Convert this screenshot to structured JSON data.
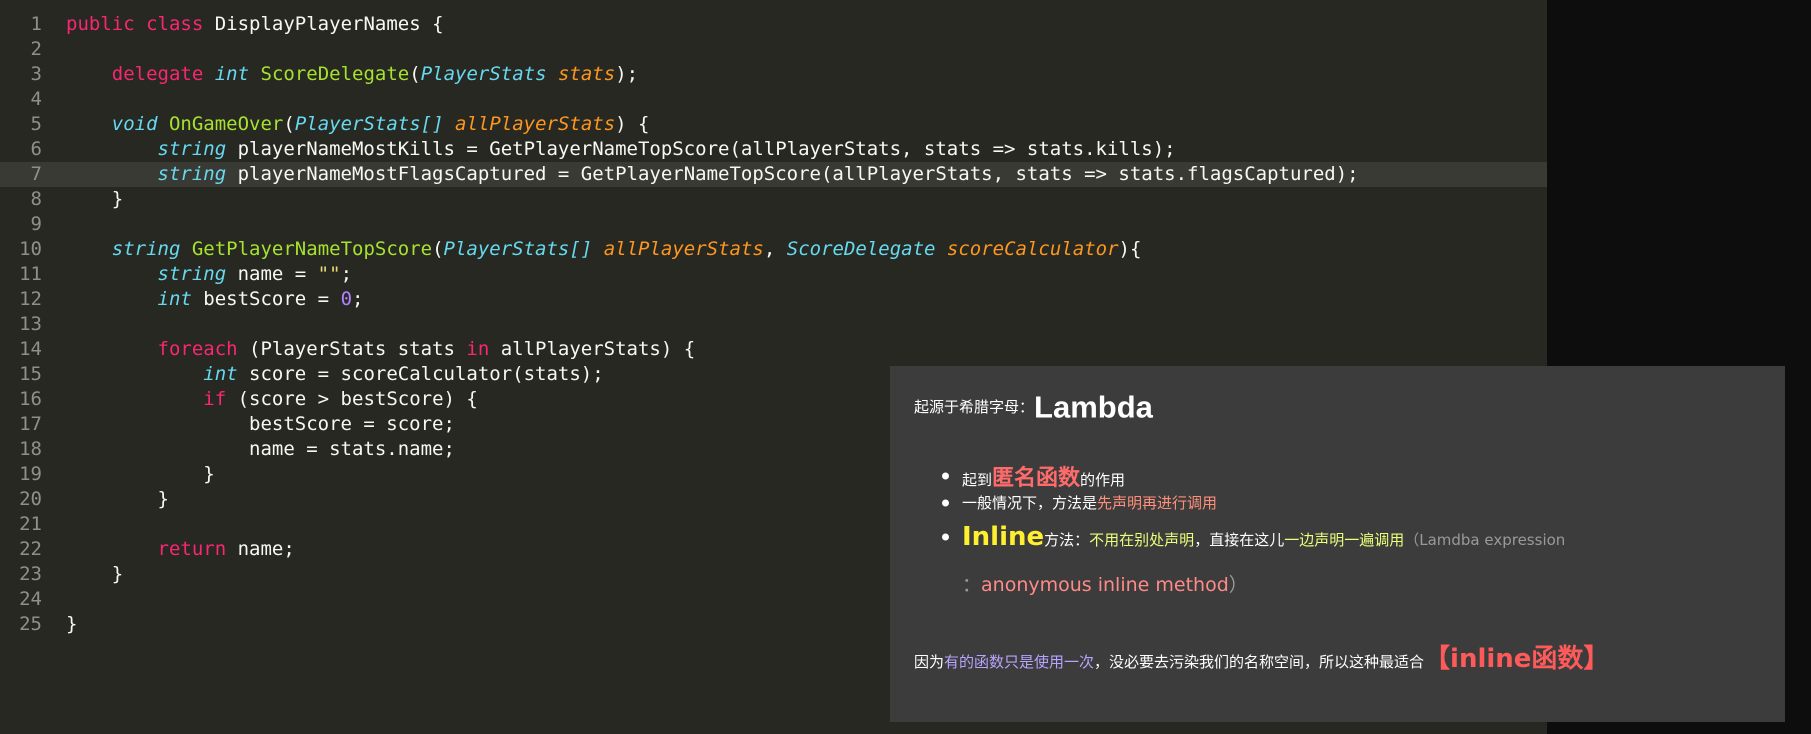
{
  "editor": {
    "current_line": 7,
    "lines": [
      {
        "n": "1",
        "tokens": [
          [
            "kw",
            "public"
          ],
          [
            "pl",
            " "
          ],
          [
            "kw",
            "class"
          ],
          [
            "pl",
            " DisplayPlayerNames {"
          ]
        ]
      },
      {
        "n": "2",
        "tokens": []
      },
      {
        "n": "3",
        "tokens": [
          [
            "pl",
            "    "
          ],
          [
            "kw",
            "delegate"
          ],
          [
            "pl",
            " "
          ],
          [
            "ty",
            "int"
          ],
          [
            "pl",
            " "
          ],
          [
            "fn",
            "ScoreDelegate"
          ],
          [
            "pl",
            "("
          ],
          [
            "ty",
            "PlayerStats"
          ],
          [
            "pl",
            " "
          ],
          [
            "pa",
            "stats"
          ],
          [
            "pl",
            ");"
          ]
        ]
      },
      {
        "n": "4",
        "tokens": []
      },
      {
        "n": "5",
        "tokens": [
          [
            "pl",
            "    "
          ],
          [
            "ty",
            "void"
          ],
          [
            "pl",
            " "
          ],
          [
            "fn",
            "OnGameOver"
          ],
          [
            "pl",
            "("
          ],
          [
            "ty",
            "PlayerStats[]"
          ],
          [
            "pl",
            " "
          ],
          [
            "pa",
            "allPlayerStats"
          ],
          [
            "pl",
            ") {"
          ]
        ]
      },
      {
        "n": "6",
        "tokens": [
          [
            "pl",
            "        "
          ],
          [
            "ty",
            "string"
          ],
          [
            "pl",
            " playerNameMostKills = GetPlayerNameTopScore(allPlayerStats, stats => stats.kills);"
          ]
        ]
      },
      {
        "n": "7",
        "tokens": [
          [
            "pl",
            "        "
          ],
          [
            "ty",
            "string"
          ],
          [
            "pl",
            " playerNameMostFlagsCaptured = GetPlayerNameTopScore(allPlayerStats, stats => stats.flagsCaptured);"
          ]
        ]
      },
      {
        "n": "8",
        "tokens": [
          [
            "pl",
            "    }"
          ]
        ]
      },
      {
        "n": "9",
        "tokens": []
      },
      {
        "n": "10",
        "tokens": [
          [
            "pl",
            "    "
          ],
          [
            "ty",
            "string"
          ],
          [
            "pl",
            " "
          ],
          [
            "fn",
            "GetPlayerNameTopScore"
          ],
          [
            "pl",
            "("
          ],
          [
            "ty",
            "PlayerStats[]"
          ],
          [
            "pl",
            " "
          ],
          [
            "pa",
            "allPlayerStats"
          ],
          [
            "pl",
            ", "
          ],
          [
            "ty",
            "ScoreDelegate"
          ],
          [
            "pl",
            " "
          ],
          [
            "pa",
            "scoreCalculator"
          ],
          [
            "pl",
            "){"
          ]
        ]
      },
      {
        "n": "11",
        "tokens": [
          [
            "pl",
            "        "
          ],
          [
            "ty",
            "string"
          ],
          [
            "pl",
            " name = "
          ],
          [
            "str",
            "\"\""
          ],
          [
            "pl",
            ";"
          ]
        ]
      },
      {
        "n": "12",
        "tokens": [
          [
            "pl",
            "        "
          ],
          [
            "ty",
            "int"
          ],
          [
            "pl",
            " bestScore = "
          ],
          [
            "num",
            "0"
          ],
          [
            "pl",
            ";"
          ]
        ]
      },
      {
        "n": "13",
        "tokens": []
      },
      {
        "n": "14",
        "tokens": [
          [
            "pl",
            "        "
          ],
          [
            "kw",
            "foreach"
          ],
          [
            "pl",
            " (PlayerStats stats "
          ],
          [
            "kw",
            "in"
          ],
          [
            "pl",
            " allPlayerStats) {"
          ]
        ]
      },
      {
        "n": "15",
        "tokens": [
          [
            "pl",
            "            "
          ],
          [
            "ty",
            "int"
          ],
          [
            "pl",
            " score = scoreCalculator(stats);"
          ]
        ]
      },
      {
        "n": "16",
        "tokens": [
          [
            "pl",
            "            "
          ],
          [
            "kw",
            "if"
          ],
          [
            "pl",
            " (score > bestScore) {"
          ]
        ]
      },
      {
        "n": "17",
        "tokens": [
          [
            "pl",
            "                bestScore = score;"
          ]
        ]
      },
      {
        "n": "18",
        "tokens": [
          [
            "pl",
            "                name = stats.name;"
          ]
        ]
      },
      {
        "n": "19",
        "tokens": [
          [
            "pl",
            "            }"
          ]
        ]
      },
      {
        "n": "20",
        "tokens": [
          [
            "pl",
            "        }"
          ]
        ]
      },
      {
        "n": "21",
        "tokens": []
      },
      {
        "n": "22",
        "tokens": [
          [
            "pl",
            "        "
          ],
          [
            "kw",
            "return"
          ],
          [
            "pl",
            " name;"
          ]
        ]
      },
      {
        "n": "23",
        "tokens": [
          [
            "pl",
            "    }"
          ]
        ]
      },
      {
        "n": "24",
        "tokens": []
      },
      {
        "n": "25",
        "tokens": [
          [
            "pl",
            "}"
          ]
        ]
      }
    ]
  },
  "overlay": {
    "title_prefix": "起源于希腊字母：",
    "title_big": "Lambda",
    "b1_a": "起到",
    "b1_red": "匿名函数",
    "b1_b": "的作用",
    "b2_a": "一般情况下，方法是",
    "b2_red": "先声明再进行调用",
    "b3_yellow": "Inline",
    "b3_a": "方法：",
    "b3_lime1": "不用在别处声明",
    "b3_b": "，直接在这儿",
    "b3_lime2": "一边声明一遍调用",
    "b3_gray1": "（Lamdba expression",
    "b3_gray2": "：",
    "b3_pink": "anonymous inline method",
    "b3_gray3": "）",
    "foot_a": "因为",
    "foot_purple": "有的函数只是使用一次",
    "foot_b": "，没必要去污染我们的名称空间，所以这种最适合",
    "foot_red": "【inline函数】"
  },
  "colors": {
    "editor_bg": "#272822",
    "keyword": "#f92672",
    "type": "#66d9ef",
    "function": "#a6e22e",
    "param": "#fd971f",
    "number": "#ae81ff",
    "string": "#e6db74",
    "overlay_bg": "#3c3c3c"
  }
}
